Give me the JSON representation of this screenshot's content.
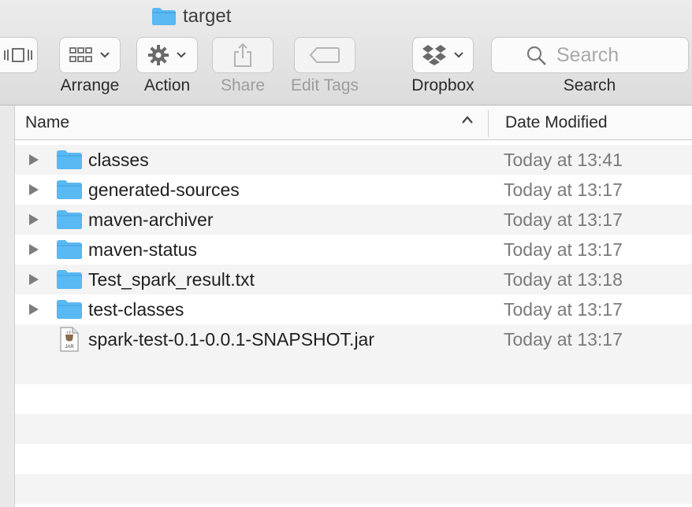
{
  "window": {
    "title": "target",
    "title_icon": "folder-icon"
  },
  "toolbar": {
    "arrange_label": "Arrange",
    "action_label": "Action",
    "share_label": "Share",
    "edit_tags_label": "Edit Tags",
    "dropbox_label": "Dropbox",
    "search_label": "Search",
    "search_placeholder": "Search"
  },
  "columns": {
    "name": "Name",
    "date_modified": "Date Modified"
  },
  "files": [
    {
      "name": "classes",
      "date": "Today at 13:41",
      "kind": "folder",
      "expandable": true
    },
    {
      "name": "generated-sources",
      "date": "Today at 13:17",
      "kind": "folder",
      "expandable": true
    },
    {
      "name": "maven-archiver",
      "date": "Today at 13:17",
      "kind": "folder",
      "expandable": true
    },
    {
      "name": "maven-status",
      "date": "Today at 13:17",
      "kind": "folder",
      "expandable": true
    },
    {
      "name": "Test_spark_result.txt",
      "date": "Today at 13:18",
      "kind": "folder",
      "expandable": true
    },
    {
      "name": "test-classes",
      "date": "Today at 13:17",
      "kind": "folder",
      "expandable": true
    },
    {
      "name": "spark-test-0.1-0.0.1-SNAPSHOT.jar",
      "date": "Today at 13:17",
      "kind": "jar",
      "expandable": false
    }
  ],
  "colors": {
    "folder": "#5ab8f2",
    "selection_alt_row": "#f4f4f4"
  }
}
